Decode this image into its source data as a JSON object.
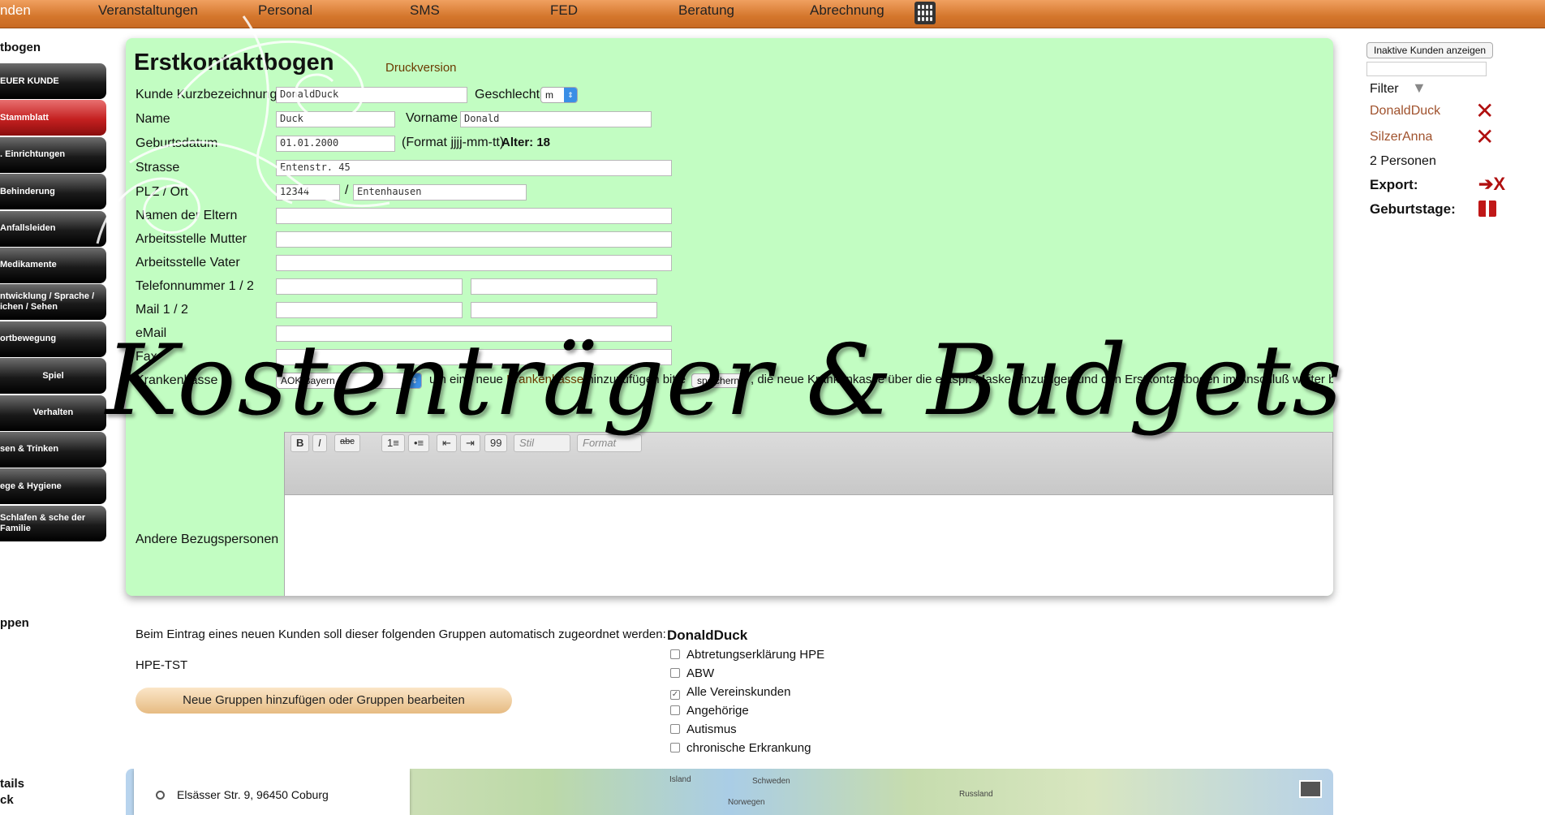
{
  "topnav": {
    "items": [
      "nden",
      "Veranstaltungen",
      "Personal",
      "SMS",
      "FED",
      "Beratung",
      "Abrechnung"
    ]
  },
  "sidebar": {
    "title": "tbogen",
    "items": [
      {
        "label": "EUER KUNDE"
      },
      {
        "label": "Stammblatt"
      },
      {
        "label": ". Einrichtungen"
      },
      {
        "label": "Behinderung"
      },
      {
        "label": "Anfallsleiden"
      },
      {
        "label": "Medikamente"
      },
      {
        "label": "ntwicklung / Sprache / ichen / Sehen"
      },
      {
        "label": "ortbewegung"
      },
      {
        "label": "Spiel"
      },
      {
        "label": "Verhalten"
      },
      {
        "label": "sen & Trinken"
      },
      {
        "label": "ege & Hygiene"
      },
      {
        "label": "Schlafen & sche der Familie"
      }
    ],
    "section_gruppen": "ppen",
    "section_details": "tails",
    "section_ck": "ck"
  },
  "form": {
    "title": "Erstkontaktbogen",
    "print_link": "Druckversion",
    "labels": {
      "kurz": "Kunde Kurzbezeichnung",
      "geschlecht": "Geschlecht",
      "name": "Name",
      "vorname": "Vorname",
      "geburtsdatum": "Geburtsdatum",
      "format": "(Format jjjj-mm-tt)",
      "alter": "Alter: 18",
      "strasse": "Strasse",
      "plz_ort": "PLZ / Ort",
      "slash": "/",
      "eltern": "Namen der Eltern",
      "arbeit_mutter": "Arbeitsstelle Mutter",
      "arbeit_vater": "Arbeitsstelle Vater",
      "telefon": "Telefonnummer 1 / 2",
      "mail12": "Mail 1 / 2",
      "email": "eMail",
      "fax": "Fax",
      "krankenkasse": "Krankenkasse",
      "kasse_hint_pre": "um eine neue",
      "kasse_link": "Krankenkasse",
      "kasse_hint_mid": "hinzuzufügen bitte",
      "kasse_hint_post": ", die neue Krankenkasse über die entspr. Maske hinzufügen und den Erstkontaktbogen im Anschluß weiter b",
      "save_btn": "speichern",
      "andere": "Andere Bezugspersonen"
    },
    "values": {
      "kurz": "DonaldDuck",
      "geschlecht": "m",
      "name": "Duck",
      "vorname": "Donald",
      "geburtsdatum": "01.01.2000",
      "strasse": "Entenstr. 45",
      "plz": "12344",
      "ort": "Entenhausen",
      "krankenkasse": "AOK Bayern"
    },
    "editor": {
      "style_select": "Stil",
      "format_select": "Format",
      "buttons": [
        "B",
        "I",
        "abc",
        "1≡",
        "•≡",
        "⇤",
        "⇥",
        "99"
      ]
    }
  },
  "right_panel": {
    "inactive_btn": "Inaktive Kunden anzeigen",
    "filter": "Filter",
    "customers": [
      "DonaldDuck",
      "SilzerAnna"
    ],
    "count": "2 Personen",
    "export": "Export:",
    "birthdays": "Geburtstage:"
  },
  "groups": {
    "intro": "Beim Eintrag eines neuen Kunden soll dieser folgenden Gruppen automatisch zugeordnet werden:",
    "selected": "HPE-TST",
    "edit_btn": "Neue Gruppen hinzufügen oder Gruppen bearbeiten",
    "customer": "DonaldDuck",
    "list": [
      {
        "label": "Abtretungserklärung HPE",
        "checked": false
      },
      {
        "label": "ABW",
        "checked": false
      },
      {
        "label": "Alle Vereinskunden",
        "checked": true
      },
      {
        "label": "Angehörige",
        "checked": false
      },
      {
        "label": "Autismus",
        "checked": false
      },
      {
        "label": "chronische Erkrankung",
        "checked": false
      }
    ]
  },
  "map": {
    "address": "Elsässer Str. 9, 96450 Coburg",
    "labels": [
      "Island",
      "Schweden",
      "Norwegen",
      "Russland"
    ]
  },
  "overlay": {
    "title": "Kostenträger & Budgets"
  }
}
